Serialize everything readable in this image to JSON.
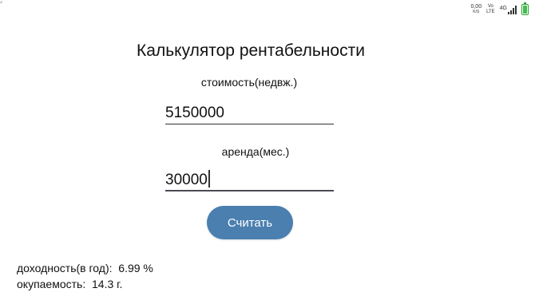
{
  "status_bar": {
    "left_mark": "ᐟ",
    "net_speed_value": "0,00",
    "net_speed_unit": "K/S",
    "volte_top": "Vo",
    "volte_bottom": "LTE",
    "network_type": "4G",
    "battery_color": "#3fbf4b"
  },
  "app": {
    "title": "Калькулятор рентабельности",
    "cost_label": "стоимость(недвж.)",
    "cost_value": "5150000",
    "rent_label": "аренда(мес.)",
    "rent_value": "30000",
    "calc_button_label": "Считать",
    "button_color": "#4a7fb0"
  },
  "results": {
    "yield_label": "доходность(в год):",
    "yield_value": "6.99 %",
    "payback_label": "окупаемость:",
    "payback_value": "14.3 г."
  }
}
